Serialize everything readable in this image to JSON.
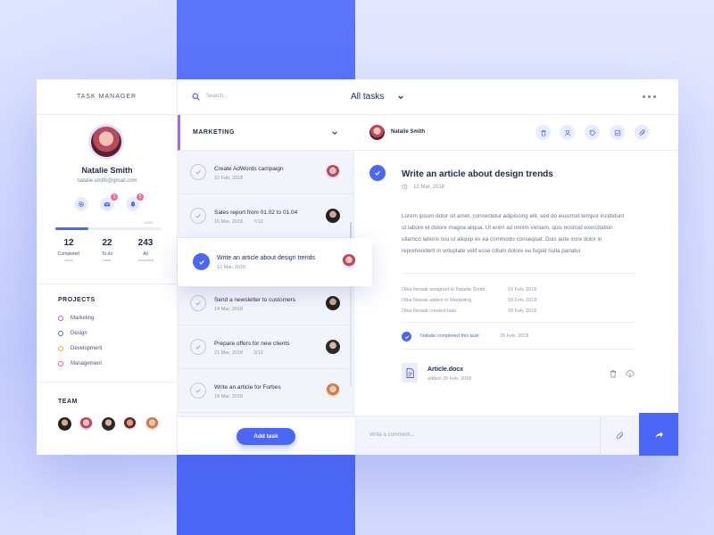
{
  "brand": "TASK MANAGER",
  "user": {
    "name": "Natalie Smith",
    "email": "natalie.smith@gmail.com"
  },
  "quick_actions": [
    {
      "icon": "gear-icon",
      "badge": ""
    },
    {
      "icon": "mail-icon",
      "badge": "2"
    },
    {
      "icon": "bell-icon",
      "badge": "5"
    }
  ],
  "progress": {
    "value": 0.31,
    "label": "12/34"
  },
  "stats": [
    {
      "value": "12",
      "label": "Completed",
      "sub": "tasks"
    },
    {
      "value": "22",
      "label": "To do",
      "sub": "tasks"
    },
    {
      "value": "243",
      "label": "All",
      "sub": "completed"
    }
  ],
  "projects": {
    "title": "PROJECTS",
    "items": [
      {
        "label": "Marketing",
        "color": "#b65cf2"
      },
      {
        "label": "Design",
        "color": "#4a67f8"
      },
      {
        "label": "Development",
        "color": "#f5a623"
      },
      {
        "label": "Management",
        "color": "#f0617a"
      }
    ]
  },
  "team": {
    "title": "TEAM"
  },
  "search": {
    "placeholder": "Search..."
  },
  "header": {
    "filter": "All tasks"
  },
  "list": {
    "group": "MARKETING",
    "tasks": [
      {
        "title": "Create AdWords campaign",
        "date": "22 Feb, 2018",
        "sub": ""
      },
      {
        "title": "Sales report from 01.02 to 01.04",
        "date": "15 Mar, 2018",
        "sub": "7/12"
      },
      {
        "title": "Write an article about design trends",
        "date": "12 Mar, 2018",
        "sub": ""
      },
      {
        "title": "Send a newsletter to customers",
        "date": "14 Mar, 2018",
        "sub": ""
      },
      {
        "title": "Prepare offers for new clients",
        "date": "21 Mar, 2018",
        "sub": "3/12"
      },
      {
        "title": "Write an article for Forbes",
        "date": "18 Mar, 2018",
        "sub": ""
      }
    ],
    "add_label": "Add task"
  },
  "detail": {
    "assignee": "Natalie Smith",
    "title": "Write an article about design trends",
    "date": "12 Mar, 2018",
    "description": "Lorem ipsum dolor sit amet, consectetur adipiscing elit, sed do eiusmod tempor incididunt ut labore et dolore magna aliqua. Ut enim ad minim veniam, quis nostrud exercitation ullamco laboris nisi ut aliquip ex ea commodo consequat. Duis aute irure dolor in reprehenderit in voluptate velit esse cillum dolore eu fugiat nulla pariatur.",
    "activity": [
      {
        "text": "Olka Nowak assigned to Natalie Smith.",
        "date": "19 Feb, 2018"
      },
      {
        "text": "Olka Nowak added to Marketing.",
        "date": "18 Feb, 2018"
      },
      {
        "text": "Olka Nowak created task.",
        "date": "18 Feb, 2018"
      }
    ],
    "completed": {
      "text": "Natalie completed this task",
      "date": "26 Feb, 2018"
    },
    "file": {
      "name": "Article.docx",
      "date": "added 26 Feb, 2018"
    },
    "comment_placeholder": "Write a comment..."
  }
}
